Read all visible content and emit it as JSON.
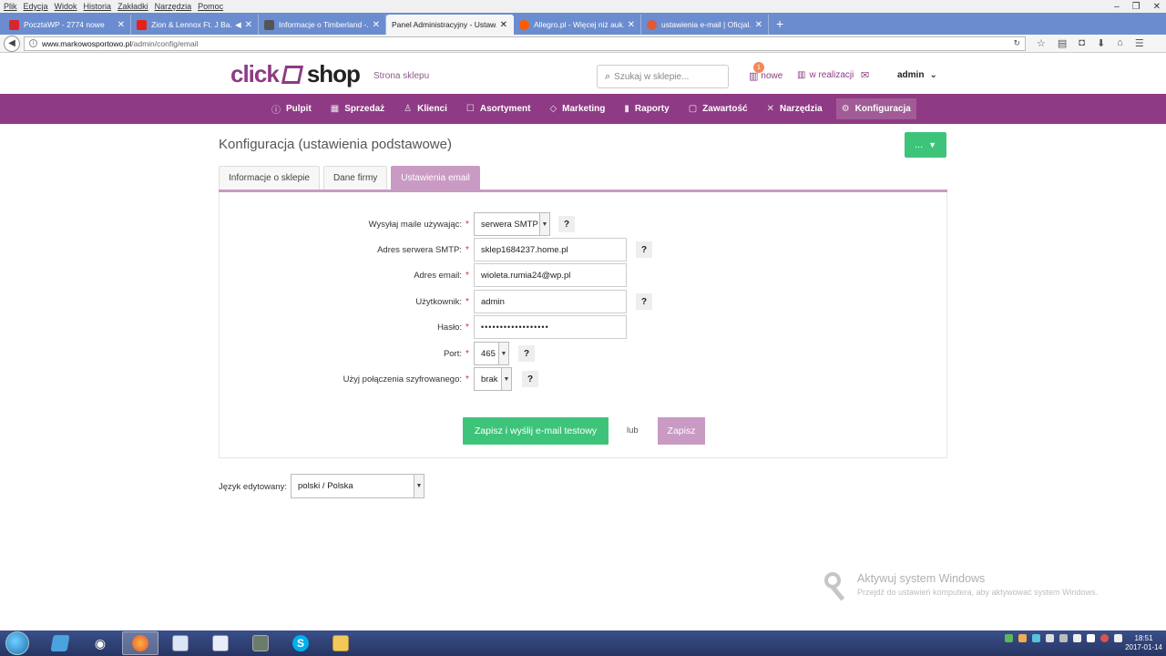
{
  "browser": {
    "menu": [
      "Plik",
      "Edycja",
      "Widok",
      "Historia",
      "Zakładki",
      "Narzędzia",
      "Pomoc"
    ],
    "tabs": [
      {
        "label": "PocztaWP - 2774 nowe",
        "color": "#d9262c",
        "active": false
      },
      {
        "label": "Zion & Lennox Ft. J Ba...",
        "color": "#e62117",
        "active": false
      },
      {
        "label": "Informacje o Timberland -...",
        "color": "#555555",
        "active": false
      },
      {
        "label": "Panel Administracyjny - Ustaw...",
        "color": "",
        "active": true
      },
      {
        "label": "Allegro.pl - Więcej niż auk...",
        "color": "#ff5a00",
        "active": false
      },
      {
        "label": "ustawienia e-mail | Oficjal...",
        "color": "#e05a3a",
        "active": false
      }
    ],
    "url": {
      "host": "www.markowosportowo.pl",
      "path": "/admin/config/email"
    }
  },
  "header": {
    "logo_left": "click",
    "logo_right": "shop",
    "store_link": "Strona sklepu",
    "search_placeholder": "Szukaj w sklepie...",
    "new_badge": "1",
    "new_label": "nowe",
    "in_progress_label": "w realizacji",
    "user": "admin"
  },
  "nav": [
    {
      "label": "Pulpit",
      "icon": "info-icon",
      "glyph": "ⓘ",
      "active": false
    },
    {
      "label": "Sprzedaż",
      "icon": "cart-icon",
      "glyph": "▦",
      "active": false
    },
    {
      "label": "Klienci",
      "icon": "users-icon",
      "glyph": "♙",
      "active": false
    },
    {
      "label": "Asortyment",
      "icon": "box-icon",
      "glyph": "☐",
      "active": false
    },
    {
      "label": "Marketing",
      "icon": "tag-icon",
      "glyph": "◇",
      "active": false
    },
    {
      "label": "Raporty",
      "icon": "chart-icon",
      "glyph": "▮",
      "active": false
    },
    {
      "label": "Zawartość",
      "icon": "document-icon",
      "glyph": "▢",
      "active": false
    },
    {
      "label": "Narzędzia",
      "icon": "tools-icon",
      "glyph": "✕",
      "active": false
    },
    {
      "label": "Konfiguracja",
      "icon": "gear-icon",
      "glyph": "⚙",
      "active": true
    }
  ],
  "page": {
    "title": "Konfiguracja (ustawienia podstawowe)",
    "more_button": "...",
    "tabs": [
      "Informacje o sklepie",
      "Dane firmy",
      "Ustawienia email"
    ],
    "active_tab": 2
  },
  "form": {
    "send_via_label": "Wysyłaj maile używając:",
    "send_via_value": "serwera SMTP",
    "smtp_label": "Adres serwera SMTP:",
    "smtp_value": "sklep1684237.home.pl",
    "email_label": "Adres email:",
    "email_value": "wioleta.rumia24@wp.pl",
    "user_label": "Użytkownik:",
    "user_value": "admin",
    "password_label": "Hasło:",
    "password_value": "••••••••••••••••••",
    "port_label": "Port:",
    "port_value": "465",
    "encryption_label": "Użyj połączenia szyfrowanego:",
    "encryption_value": "brak",
    "required_mark": "*",
    "help_mark": "?",
    "test_button": "Zapisz i wyślij e-mail testowy",
    "or_text": "lub",
    "save_button": "Zapisz"
  },
  "language": {
    "label": "Język edytowany:",
    "value": "polski / Polska"
  },
  "watermark": {
    "title": "Aktywuj system Windows",
    "subtitle": "Przejdź do ustawień komputera, aby aktywować system Windows."
  },
  "taskbar": {
    "time": "18:51",
    "date": "2017-01-14"
  },
  "colors": {
    "brand_purple": "#8e3a84",
    "tab_active": "#c99ac3",
    "green": "#3ec47a"
  }
}
